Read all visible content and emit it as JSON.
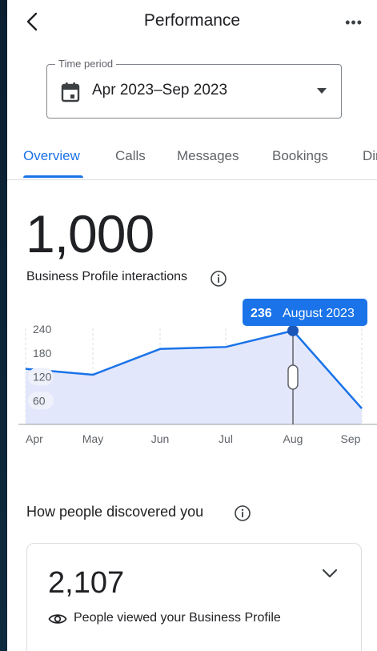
{
  "header": {
    "title": "Performance",
    "more_label": "•••"
  },
  "time_period": {
    "label": "Time period",
    "value": "Apr 2023–Sep 2023"
  },
  "tabs": [
    {
      "label": "Overview",
      "active": true
    },
    {
      "label": "Calls",
      "active": false
    },
    {
      "label": "Messages",
      "active": false
    },
    {
      "label": "Bookings",
      "active": false
    },
    {
      "label": "Dir",
      "active": false
    }
  ],
  "summary": {
    "value": "1,000",
    "label": "Business Profile interactions"
  },
  "chart_data": {
    "type": "area",
    "x": [
      "Apr",
      "May",
      "Jun",
      "Jul",
      "Aug",
      "Sep"
    ],
    "series": [
      {
        "values": [
          140,
          125,
          190,
          195,
          236,
          40
        ]
      }
    ],
    "ytick_labels": [
      "240",
      "180",
      "120",
      "60"
    ],
    "ylim": [
      0,
      255
    ],
    "tooltip": {
      "value": "236",
      "label": "August 2023"
    },
    "grid": "vertical dashed",
    "colors": {
      "line": "#1a73e8",
      "fill": "#e3e7fb",
      "tooltip": "#1a73e8"
    }
  },
  "discovery": {
    "title": "How people discovered you",
    "card_value": "2,107",
    "card_label": "People viewed your Business Profile"
  },
  "icons": {
    "back": "back-arrow-icon",
    "calendar": "calendar-icon",
    "dropdown": "dropdown-arrow-icon",
    "info": "info-icon",
    "chevron": "chevron-down-icon",
    "eye": "eye-icon"
  }
}
